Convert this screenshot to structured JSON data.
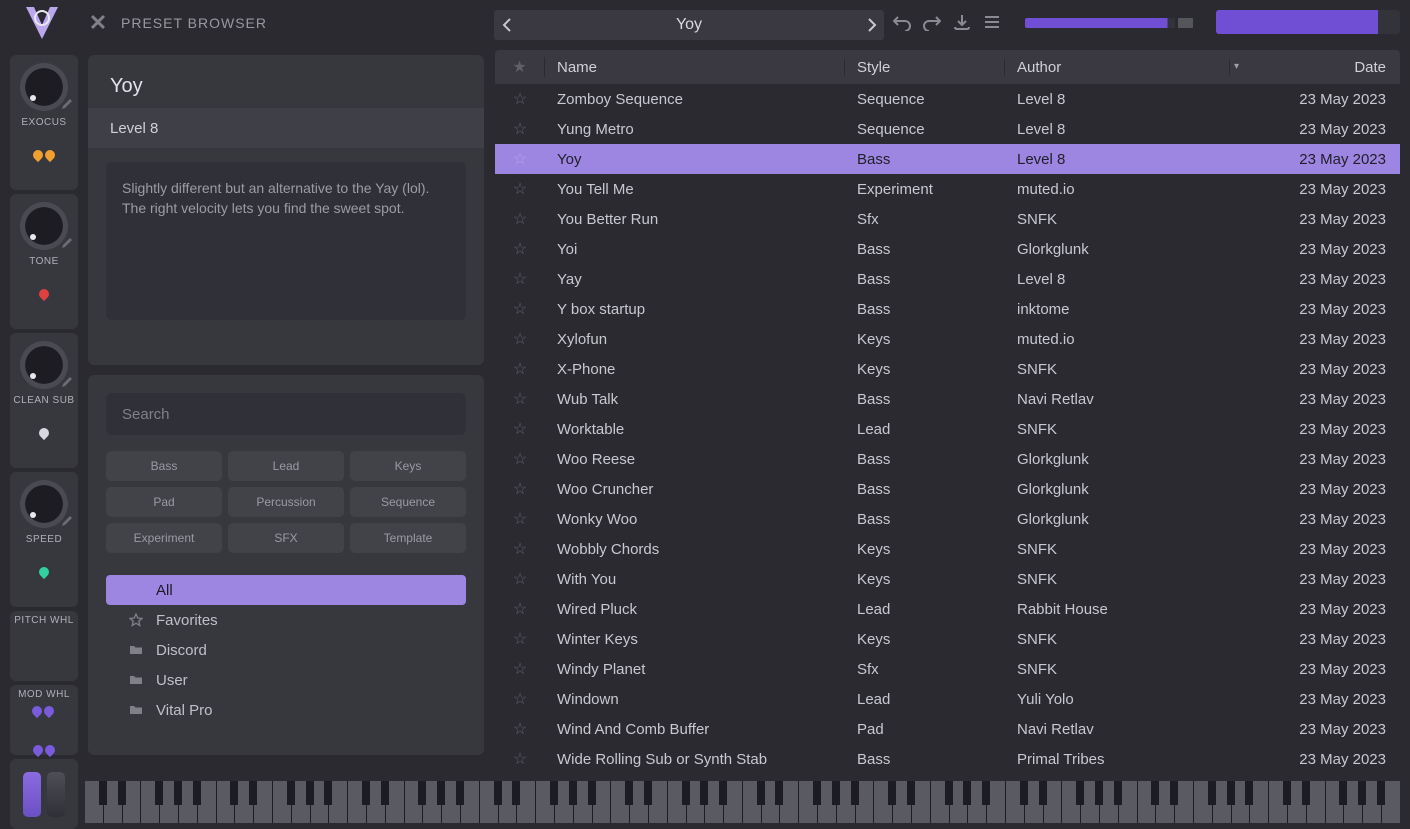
{
  "header": {
    "browser_title": "PRESET BROWSER",
    "current_preset": "Yoy"
  },
  "macros": [
    {
      "label": "EXOCUS",
      "accent1": "#f0a030",
      "accent2": "#f0a030"
    },
    {
      "label": "TONE",
      "accent1": "#e04040",
      "accent2": ""
    },
    {
      "label": "CLEAN SUB",
      "accent1": "#d8d8e0",
      "accent2": ""
    },
    {
      "label": "SPEED",
      "accent1": "#30d0a0",
      "accent2": ""
    }
  ],
  "wheel_labels": {
    "pitch": "PITCH WHL",
    "mod": "MOD WHL"
  },
  "info": {
    "title": "Yoy",
    "author": "Level 8",
    "desc": "Slightly different but an alternative to the Yay (lol). The right velocity lets you find the sweet spot."
  },
  "filters": {
    "search_placeholder": "Search",
    "tags": [
      "Bass",
      "Lead",
      "Keys",
      "Pad",
      "Percussion",
      "Sequence",
      "Experiment",
      "SFX",
      "Template"
    ],
    "folders": [
      {
        "label": "All",
        "icon": "none",
        "selected": true
      },
      {
        "label": "Favorites",
        "icon": "star",
        "selected": false
      },
      {
        "label": "Discord",
        "icon": "folder",
        "selected": false
      },
      {
        "label": "User",
        "icon": "folder",
        "selected": false
      },
      {
        "label": "Vital Pro",
        "icon": "folder",
        "selected": false
      }
    ]
  },
  "table": {
    "columns": {
      "name": "Name",
      "style": "Style",
      "author": "Author",
      "date": "Date"
    },
    "rows": [
      {
        "name": "Zomboy Sequence",
        "style": "Sequence",
        "author": "Level 8",
        "date": "23 May 2023"
      },
      {
        "name": "Yung Metro",
        "style": "Sequence",
        "author": "Level 8",
        "date": "23 May 2023"
      },
      {
        "name": "Yoy",
        "style": "Bass",
        "author": "Level 8",
        "date": "23 May 2023",
        "selected": true
      },
      {
        "name": "You Tell Me",
        "style": "Experiment",
        "author": "muted.io",
        "date": "23 May 2023"
      },
      {
        "name": "You Better Run",
        "style": "Sfx",
        "author": "SNFK",
        "date": "23 May 2023"
      },
      {
        "name": "Yoi",
        "style": "Bass",
        "author": "Glorkglunk",
        "date": "23 May 2023"
      },
      {
        "name": "Yay",
        "style": "Bass",
        "author": "Level 8",
        "date": "23 May 2023"
      },
      {
        "name": "Y box startup",
        "style": "Bass",
        "author": "inktome",
        "date": "23 May 2023"
      },
      {
        "name": "Xylofun",
        "style": "Keys",
        "author": "muted.io",
        "date": "23 May 2023"
      },
      {
        "name": "X-Phone",
        "style": "Keys",
        "author": "SNFK",
        "date": "23 May 2023"
      },
      {
        "name": "Wub Talk",
        "style": "Bass",
        "author": "Navi Retlav",
        "date": "23 May 2023"
      },
      {
        "name": "Worktable",
        "style": "Lead",
        "author": "SNFK",
        "date": "23 May 2023"
      },
      {
        "name": "Woo Reese",
        "style": "Bass",
        "author": "Glorkglunk",
        "date": "23 May 2023"
      },
      {
        "name": "Woo Cruncher",
        "style": "Bass",
        "author": "Glorkglunk",
        "date": "23 May 2023"
      },
      {
        "name": "Wonky Woo",
        "style": "Bass",
        "author": "Glorkglunk",
        "date": "23 May 2023"
      },
      {
        "name": "Wobbly Chords",
        "style": "Keys",
        "author": "SNFK",
        "date": "23 May 2023"
      },
      {
        "name": "With You",
        "style": "Keys",
        "author": "SNFK",
        "date": "23 May 2023"
      },
      {
        "name": "Wired Pluck",
        "style": "Lead",
        "author": "Rabbit House",
        "date": "23 May 2023"
      },
      {
        "name": "Winter Keys",
        "style": "Keys",
        "author": "SNFK",
        "date": "23 May 2023"
      },
      {
        "name": "Windy Planet",
        "style": "Sfx",
        "author": "SNFK",
        "date": "23 May 2023"
      },
      {
        "name": "Windown",
        "style": "Lead",
        "author": "Yuli Yolo",
        "date": "23 May 2023"
      },
      {
        "name": "Wind And Comb Buffer",
        "style": "Pad",
        "author": "Navi Retlav",
        "date": "23 May 2023"
      },
      {
        "name": "Wide Rolling Sub or Synth Stab",
        "style": "Bass",
        "author": "Primal Tribes",
        "date": "23 May 2023"
      }
    ]
  }
}
